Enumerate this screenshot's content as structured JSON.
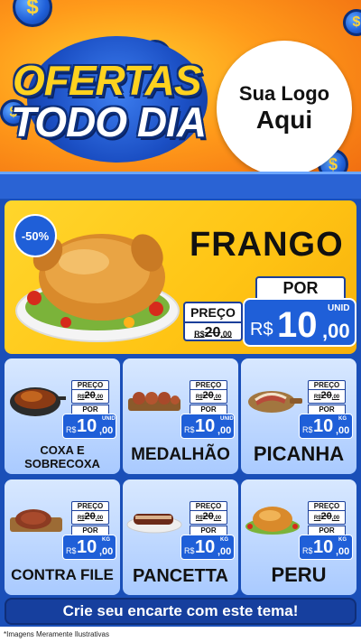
{
  "header": {
    "title_line_1": "OFERTAS",
    "title_line_2": "TODO DIA",
    "logo_line_1": "Sua Logo",
    "logo_line_2": "Aqui",
    "coin_symbol": "$"
  },
  "featured": {
    "discount_badge": "-50%",
    "name": "FRANGO",
    "preco_label": "PREÇO",
    "old_price_currency": "R$",
    "old_price_int": "20",
    "old_price_dec": ",00",
    "por_label": "POR",
    "new_price_currency": "R$",
    "new_price_int": "10",
    "new_price_dec": ",00",
    "unit": "UNID"
  },
  "products": [
    {
      "name": "COXA E SOBRECOXA",
      "preco_label": "PREÇO",
      "old_currency": "R$",
      "old_int": "20",
      "old_dec": ",00",
      "por_label": "POR",
      "currency": "R$",
      "int": "10",
      "dec": ",00",
      "unit": "UNID",
      "icon": "roast-chicken-pan-icon"
    },
    {
      "name": "MEDALHÃO",
      "preco_label": "PREÇO",
      "old_currency": "R$",
      "old_int": "20",
      "old_dec": ",00",
      "por_label": "POR",
      "currency": "R$",
      "int": "10",
      "dec": ",00",
      "unit": "UNID",
      "icon": "medallion-board-icon"
    },
    {
      "name": "PICANHA",
      "preco_label": "PREÇO",
      "old_currency": "R$",
      "old_int": "20",
      "old_dec": ",00",
      "por_label": "POR",
      "currency": "R$",
      "int": "10",
      "dec": ",00",
      "unit": "KG",
      "icon": "picanha-board-icon"
    },
    {
      "name": "CONTRA FILE",
      "preco_label": "PREÇO",
      "old_currency": "R$",
      "old_int": "20",
      "old_dec": ",00",
      "por_label": "POR",
      "currency": "R$",
      "int": "10",
      "dec": ",00",
      "unit": "KG",
      "icon": "steak-board-icon"
    },
    {
      "name": "PANCETTA",
      "preco_label": "PREÇO",
      "old_currency": "R$",
      "old_int": "20",
      "old_dec": ",00",
      "por_label": "POR",
      "currency": "R$",
      "int": "10",
      "dec": ",00",
      "unit": "KG",
      "icon": "pancetta-platter-icon"
    },
    {
      "name": "PERU",
      "preco_label": "PREÇO",
      "old_currency": "R$",
      "old_int": "20",
      "old_dec": ",00",
      "por_label": "POR",
      "currency": "R$",
      "int": "10",
      "dec": ",00",
      "unit": "KG",
      "icon": "roast-turkey-icon"
    }
  ],
  "cta_text": "Crie seu encarte com este tema!",
  "disclaimer": "*Imagens Meramente Ilustrativas",
  "colors": {
    "brand_blue": "#1f5fd8",
    "header_orange": "#ff9a1a",
    "featured_yellow": "#ffd62c",
    "title_yellow": "#ffd21f"
  }
}
